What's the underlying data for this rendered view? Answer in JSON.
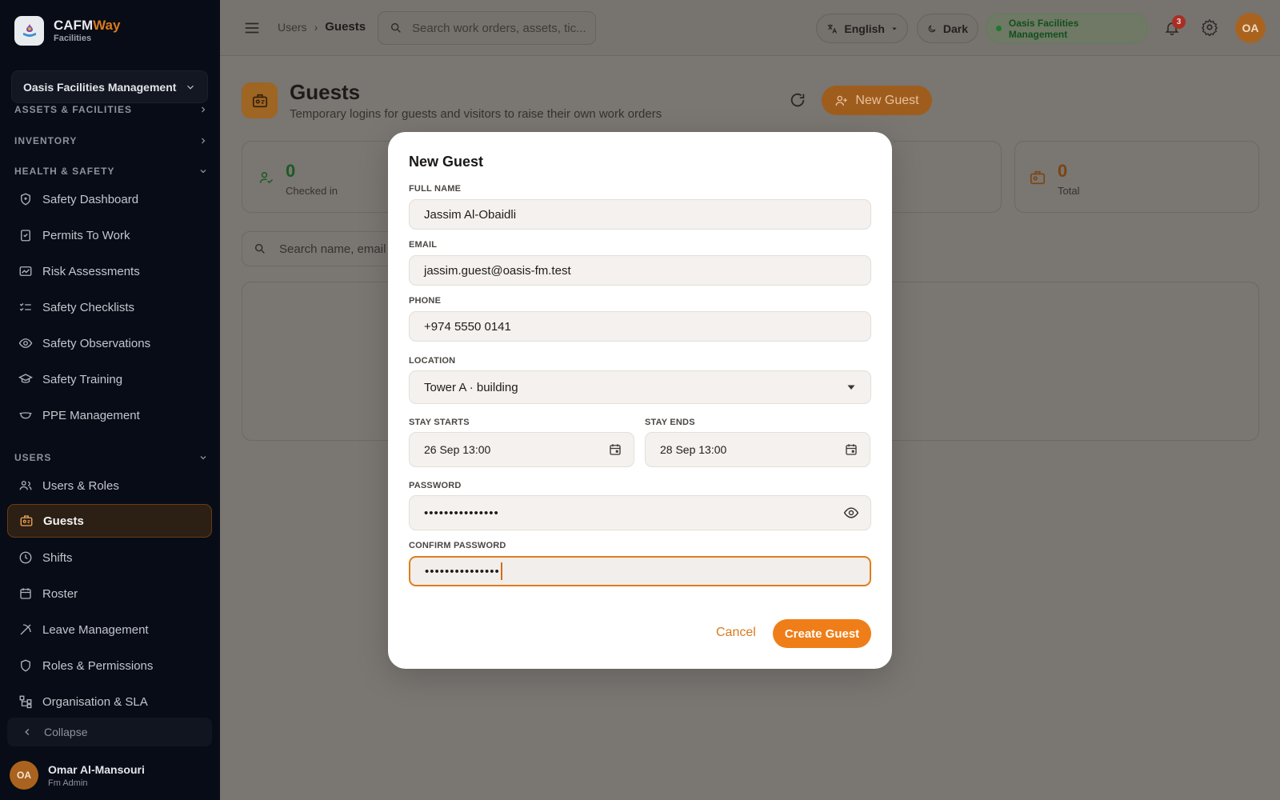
{
  "brand": {
    "name_main": "CAFM",
    "name_accent": "Way",
    "subtitle": "Facilities"
  },
  "sidebar": {
    "org_selector": "Oasis Facilities Management",
    "sections": {
      "assets": "ASSETS & FACILITIES",
      "inventory": "INVENTORY",
      "health_safety": "HEALTH & SAFETY",
      "users": "USERS"
    },
    "health_items": [
      {
        "label": "Safety Dashboard",
        "icon": "shield-icon"
      },
      {
        "label": "Permits To Work",
        "icon": "clipboard-check-icon"
      },
      {
        "label": "Risk Assessments",
        "icon": "chart-icon"
      },
      {
        "label": "Safety Checklists",
        "icon": "checklist-icon"
      },
      {
        "label": "Safety Observations",
        "icon": "eye-icon"
      },
      {
        "label": "Safety Training",
        "icon": "graduation-icon"
      },
      {
        "label": "PPE Management",
        "icon": "mask-icon"
      }
    ],
    "user_items": [
      {
        "label": "Users & Roles",
        "icon": "users-icon"
      },
      {
        "label": "Guests",
        "icon": "badge-icon"
      },
      {
        "label": "Shifts",
        "icon": "clock-icon"
      },
      {
        "label": "Roster",
        "icon": "calendar-icon"
      },
      {
        "label": "Leave Management",
        "icon": "leave-icon"
      },
      {
        "label": "Roles & Permissions",
        "icon": "shield-outline-icon"
      },
      {
        "label": "Organisation & SLA",
        "icon": "org-chart-icon"
      }
    ],
    "collapse_label": "Collapse",
    "user": {
      "initials": "OA",
      "name": "Omar Al-Mansouri",
      "role": "Fm Admin"
    }
  },
  "topbar": {
    "breadcrumb_parent": "Users",
    "breadcrumb_current": "Guests",
    "search_placeholder": "Search work orders, assets, tic...",
    "language": "English",
    "theme": "Dark",
    "org": "Oasis Facilities Management",
    "notifications": "3",
    "avatar": "OA"
  },
  "page": {
    "title": "Guests",
    "subtitle": "Temporary logins for guests and visitors to raise their own work orders",
    "new_button": "New Guest",
    "stats": [
      {
        "value": "0",
        "label": "Checked in"
      },
      {
        "value": "0",
        "label": "Total"
      }
    ],
    "search_placeholder": "Search name, email"
  },
  "modal": {
    "title": "New Guest",
    "full_name": {
      "label": "FULL NAME",
      "value": "Jassim Al-Obaidli"
    },
    "email": {
      "label": "EMAIL",
      "value": "jassim.guest@oasis-fm.test"
    },
    "phone": {
      "label": "PHONE",
      "value": "+974 5550 0141"
    },
    "location": {
      "label": "LOCATION",
      "value": "Tower A · building"
    },
    "stay_starts": {
      "label": "STAY STARTS",
      "value": "26 Sep 13:00"
    },
    "stay_ends": {
      "label": "STAY ENDS",
      "value": "28 Sep 13:00"
    },
    "password": {
      "label": "PASSWORD",
      "value": "•••••••••••••••"
    },
    "confirm_password": {
      "label": "CONFIRM PASSWORD",
      "value": "•••••••••••••••"
    },
    "cancel": "Cancel",
    "create": "Create Guest"
  },
  "colors": {
    "accent": "#ef7e18",
    "sidebar_bg": "#080c16",
    "success": "#1d7a2d"
  }
}
